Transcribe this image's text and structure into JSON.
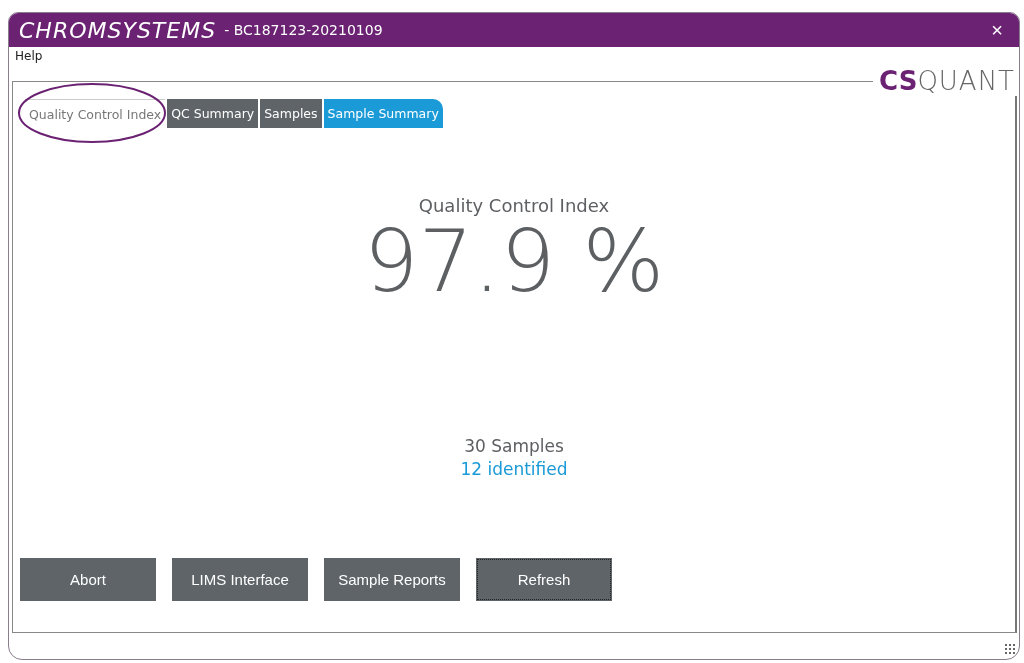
{
  "window": {
    "brand": "CHROMSYSTEMS",
    "title": "- BC187123-20210109",
    "close": "×"
  },
  "menu": [
    "Help"
  ],
  "logo": {
    "bold": "CS",
    "light": "QUANT"
  },
  "tabs": [
    {
      "label": "Quality Control Index",
      "selected": true,
      "circled": true,
      "color": "#ffffff"
    },
    {
      "label": "QC Summary",
      "selected": false,
      "circled": false,
      "color": "#5f6468"
    },
    {
      "label": "Samples",
      "selected": false,
      "circled": false,
      "color": "#5f6468"
    },
    {
      "label": "Sample Summary",
      "selected": false,
      "circled": false,
      "color": "#1a9ad6"
    }
  ],
  "index": {
    "label": "Quality Control Index",
    "value": "97.9 %"
  },
  "samples": {
    "count": "30 Samples",
    "identified": "12 identified"
  },
  "buttons": [
    {
      "label": "Abort",
      "focused": false
    },
    {
      "label": "LIMS Interface",
      "focused": false
    },
    {
      "label": "Sample Reports",
      "focused": false
    },
    {
      "label": "Refresh",
      "focused": true
    }
  ]
}
